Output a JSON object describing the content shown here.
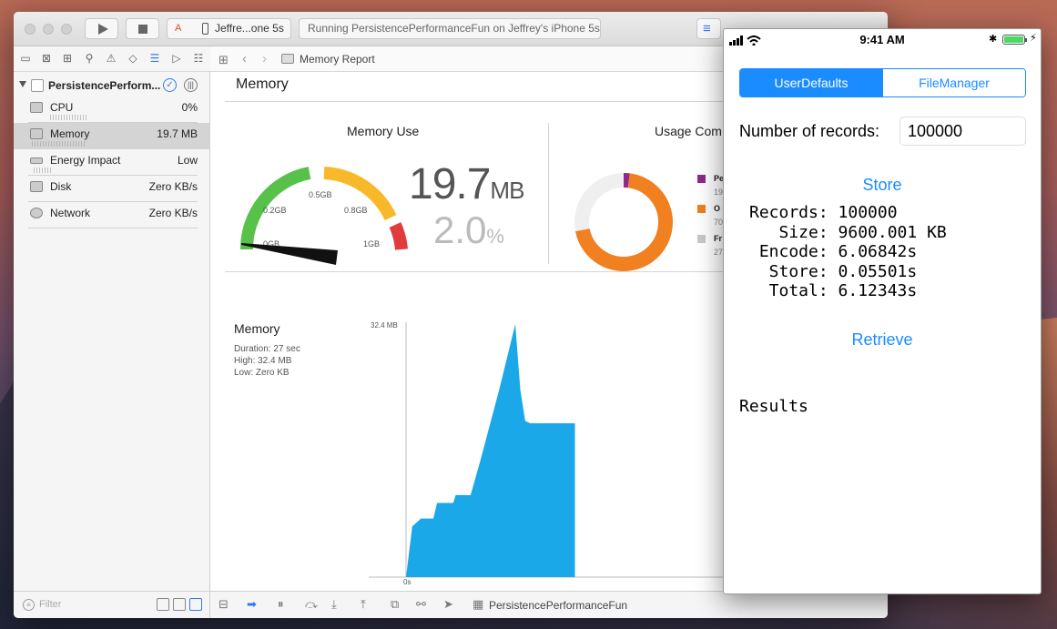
{
  "xcode": {
    "scheme_device": "Jeffre...one 5s",
    "status": "Running PersistencePerformanceFun on Jeffrey's iPhone 5s",
    "jump_bar": "Memory Report",
    "project_name": "PersistencePerform...",
    "gauges": [
      {
        "label": "CPU",
        "value": "0%"
      },
      {
        "label": "Memory",
        "value": "19.7 MB"
      },
      {
        "label": "Energy Impact",
        "value": "Low"
      },
      {
        "label": "Disk",
        "value": "Zero KB/s"
      },
      {
        "label": "Network",
        "value": "Zero KB/s"
      }
    ],
    "filter_placeholder": "Filter",
    "bottom_target": "PersistencePerformanceFun",
    "colors": {
      "accent": "#3478f6",
      "graph": "#1ba8e8"
    }
  },
  "report": {
    "title": "Memory",
    "memory_use_title": "Memory Use",
    "usage_title": "Usage Com",
    "big_value": "19.7",
    "big_unit": "MB",
    "percent_value": "2.0",
    "percent_unit": "%",
    "gauge_labels": [
      "0GB",
      "0.2GB",
      "0.5GB",
      "0.8GB",
      "1GB"
    ],
    "legend": [
      {
        "short": "Pe",
        "value": "19",
        "color": "#8e2a8e"
      },
      {
        "short": "O",
        "value": "70",
        "color": "#f08020"
      },
      {
        "short": "Fr",
        "value": "27",
        "color": "#c8c8c8"
      }
    ],
    "graph_title": "Memory",
    "duration": "Duration: 27 sec",
    "high": "High: 32.4 MB",
    "low": "Low: Zero KB",
    "y_max_label": "32.4 MB",
    "x_zero_label": "0s"
  },
  "chart_data": [
    {
      "type": "pie",
      "labels": [
        "Pe",
        "O",
        "Fr"
      ],
      "values": [
        2.0,
        70,
        28
      ],
      "colors": [
        "#8e2a8e",
        "#f08020",
        "#efefef"
      ]
    },
    {
      "type": "area",
      "ylabel": "",
      "xlabel": "",
      "ylim": [
        0,
        32.4
      ],
      "x": [
        0,
        0.5,
        1.2,
        2.2,
        2.5,
        3.8,
        4.0,
        5.2,
        6.0,
        7.5,
        8.8,
        9.2,
        9.6,
        10.0,
        13.6,
        13.6
      ],
      "y": [
        0,
        6.5,
        7.5,
        7.5,
        9.5,
        9.5,
        10.5,
        10.5,
        15,
        24,
        32.4,
        24,
        20,
        19.7,
        19.7,
        0
      ]
    }
  ],
  "sim": {
    "time": "9:41 AM",
    "seg_left": "UserDefaults",
    "seg_right": "FileManager",
    "records_label": "Number of records:",
    "records_value": "100000",
    "store_button": "Store",
    "stats": [
      "Records: 100000",
      "   Size: 9600.001 KB",
      " Encode: 6.06842s",
      "  Store: 0.05501s",
      "  Total: 6.12343s"
    ],
    "retrieve_button": "Retrieve",
    "results_label": "Results"
  }
}
